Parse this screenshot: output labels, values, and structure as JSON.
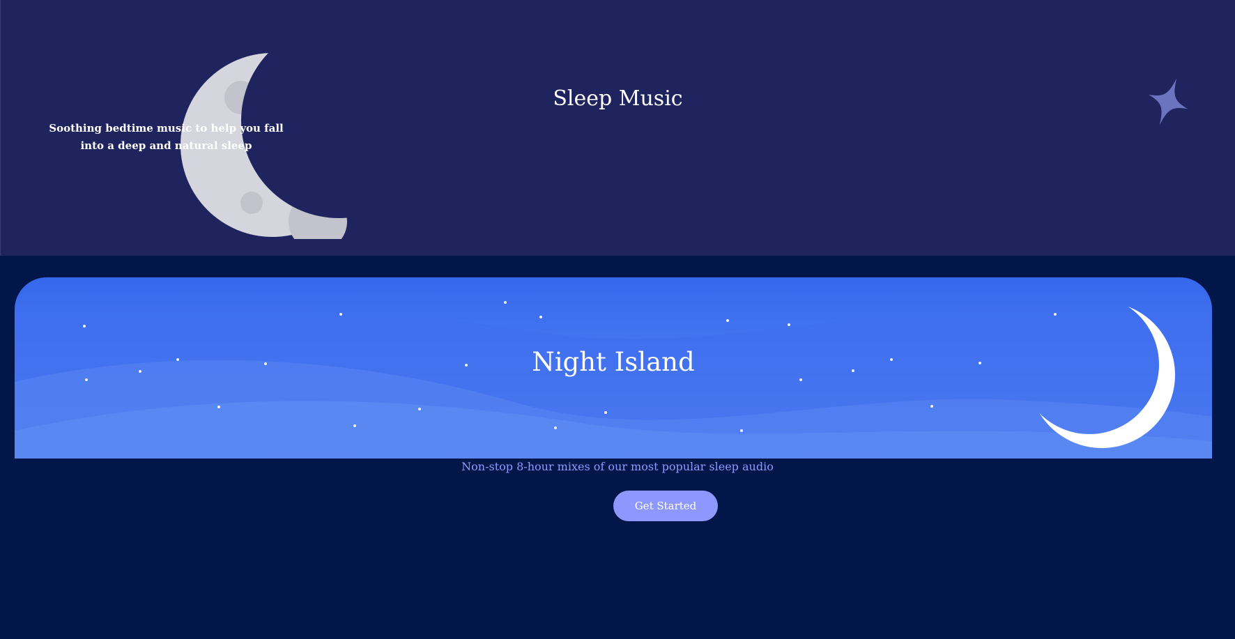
{
  "hero": {
    "title": "Sleep Music",
    "subtitle": "Soothing bedtime music to help you fall into a deep and natural sleep"
  },
  "banner": {
    "title": "Night Island",
    "tagline": "Non-stop 8-hour mixes of our most popular sleep audio"
  },
  "cta": {
    "label": "Get Started"
  },
  "colors": {
    "hero_bg": "#1f245f",
    "page_bg": "#03164a",
    "banner_top": "#3568ec",
    "banner_bottom": "#5c88f2",
    "accent": "#8e97fd",
    "tagline": "#8c9bff",
    "moon": "#d5d5dd",
    "star": "#6a74bf"
  },
  "icons": {
    "hero_moon": "crescent-moon-icon",
    "hero_star": "sparkle-star-icon",
    "banner_moon": "crescent-moon-icon"
  }
}
